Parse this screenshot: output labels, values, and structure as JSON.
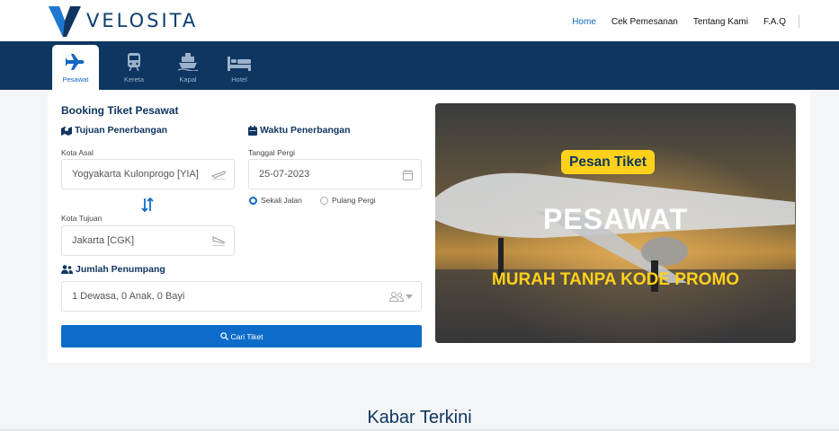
{
  "header": {
    "brand": "VELOSITA",
    "nav": [
      {
        "label": "Home",
        "active": true
      },
      {
        "label": "Cek Pemesanan",
        "active": false
      },
      {
        "label": "Tentang Kami",
        "active": false
      },
      {
        "label": "F.A.Q",
        "active": false
      }
    ]
  },
  "tabs": [
    {
      "label": "Pesawat",
      "icon": "plane-icon",
      "active": true
    },
    {
      "label": "Kereta",
      "icon": "train-icon",
      "active": false
    },
    {
      "label": "Kapal",
      "icon": "ship-icon",
      "active": false
    },
    {
      "label": "Hotel",
      "icon": "bed-icon",
      "active": false
    }
  ],
  "form": {
    "title": "Booking Tiket Pesawat",
    "route_heading": "Tujuan Penerbangan",
    "origin_label": "Kota Asal",
    "origin_value": "Yogyakarta Kulonprogo [YIA]",
    "destination_label": "Kota Tujuan",
    "destination_value": "Jakarta [CGK]",
    "time_heading": "Waktu Penerbangan",
    "date_label": "Tanggal Pergi",
    "date_value": "25-07-2023",
    "trip_one_way": "Sekali Jalan",
    "trip_round": "Pulang Pergi",
    "trip_selected": "Sekali Jalan",
    "passenger_heading": "Jumlah Penumpang",
    "passenger_value": "1 Dewasa, 0 Anak, 0 Bayi",
    "search_button": "Cari Tiket"
  },
  "banner": {
    "tag": "Pesan Tiket",
    "headline": "PESAWAT",
    "subline": "MURAH TANPA KODE PROMO"
  },
  "section_title": "Kabar Terkini",
  "colors": {
    "navy": "#0f3660",
    "primary": "#0d6cc9",
    "accent_yellow": "#ffd11a"
  }
}
